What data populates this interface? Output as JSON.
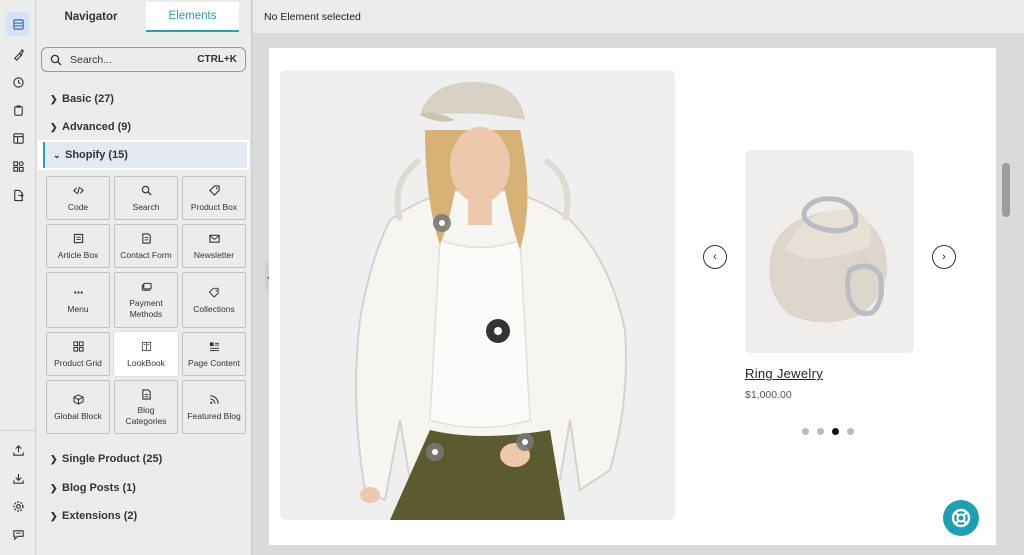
{
  "panel": {
    "tabs": {
      "navigator": "Navigator",
      "elements": "Elements"
    },
    "search": {
      "placeholder": "Search...",
      "shortcut": "CTRL+K"
    },
    "categories": {
      "basic": "Basic (27)",
      "advanced": "Advanced (9)",
      "shopify": "Shopify (15)",
      "single_product": "Single Product (25)",
      "blog_posts": "Blog Posts (1)",
      "extensions": "Extensions (2)"
    },
    "elements": [
      {
        "label": "Code",
        "icon": "code-icon"
      },
      {
        "label": "Search",
        "icon": "search-icon"
      },
      {
        "label": "Product Box",
        "icon": "tag-icon"
      },
      {
        "label": "Article Box",
        "icon": "article-icon"
      },
      {
        "label": "Contact Form",
        "icon": "form-icon"
      },
      {
        "label": "Newsletter",
        "icon": "mail-icon"
      },
      {
        "label": "Menu",
        "icon": "ellipsis-icon"
      },
      {
        "label": "Payment Methods",
        "icon": "payment-icon"
      },
      {
        "label": "Collections",
        "icon": "collections-icon"
      },
      {
        "label": "Product Grid",
        "icon": "grid-icon"
      },
      {
        "label": "LookBook",
        "icon": "lookbook-icon"
      },
      {
        "label": "Page Content",
        "icon": "page-content-icon"
      },
      {
        "label": "Global Block",
        "icon": "cube-icon"
      },
      {
        "label": "Blog Categories",
        "icon": "blog-categories-icon"
      },
      {
        "label": "Featured Blog",
        "icon": "rss-icon"
      }
    ]
  },
  "topbar": {
    "status": "No Element selected"
  },
  "lookbook": {
    "product_title": "Ring Jewelry",
    "product_price": "$1,000.00",
    "active_slide": 3,
    "slide_count": 4
  },
  "colors": {
    "accent": "#25a3b4",
    "help_button": "#1f9fb3"
  }
}
